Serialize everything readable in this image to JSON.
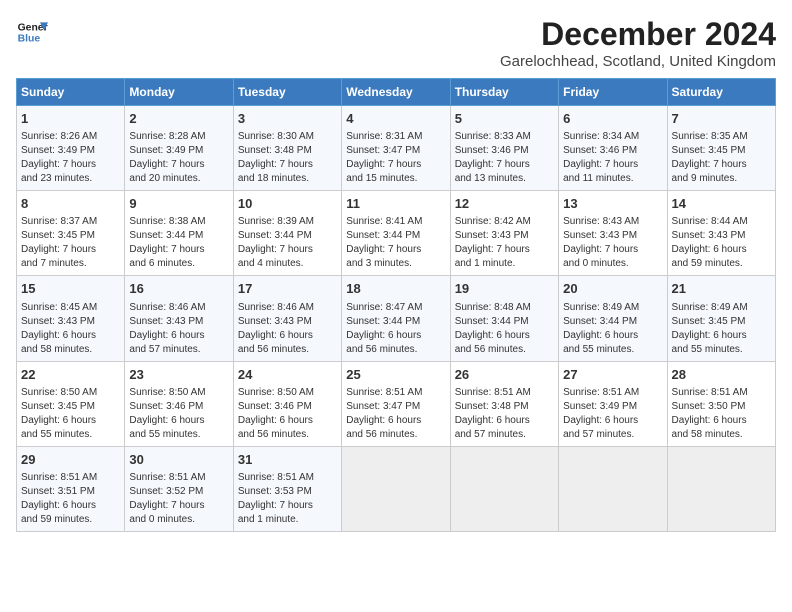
{
  "header": {
    "logo_line1": "General",
    "logo_line2": "Blue",
    "title": "December 2024",
    "subtitle": "Garelochhead, Scotland, United Kingdom"
  },
  "weekdays": [
    "Sunday",
    "Monday",
    "Tuesday",
    "Wednesday",
    "Thursday",
    "Friday",
    "Saturday"
  ],
  "weeks": [
    [
      {
        "day": 1,
        "info": "Sunrise: 8:26 AM\nSunset: 3:49 PM\nDaylight: 7 hours\nand 23 minutes."
      },
      {
        "day": 2,
        "info": "Sunrise: 8:28 AM\nSunset: 3:49 PM\nDaylight: 7 hours\nand 20 minutes."
      },
      {
        "day": 3,
        "info": "Sunrise: 8:30 AM\nSunset: 3:48 PM\nDaylight: 7 hours\nand 18 minutes."
      },
      {
        "day": 4,
        "info": "Sunrise: 8:31 AM\nSunset: 3:47 PM\nDaylight: 7 hours\nand 15 minutes."
      },
      {
        "day": 5,
        "info": "Sunrise: 8:33 AM\nSunset: 3:46 PM\nDaylight: 7 hours\nand 13 minutes."
      },
      {
        "day": 6,
        "info": "Sunrise: 8:34 AM\nSunset: 3:46 PM\nDaylight: 7 hours\nand 11 minutes."
      },
      {
        "day": 7,
        "info": "Sunrise: 8:35 AM\nSunset: 3:45 PM\nDaylight: 7 hours\nand 9 minutes."
      }
    ],
    [
      {
        "day": 8,
        "info": "Sunrise: 8:37 AM\nSunset: 3:45 PM\nDaylight: 7 hours\nand 7 minutes."
      },
      {
        "day": 9,
        "info": "Sunrise: 8:38 AM\nSunset: 3:44 PM\nDaylight: 7 hours\nand 6 minutes."
      },
      {
        "day": 10,
        "info": "Sunrise: 8:39 AM\nSunset: 3:44 PM\nDaylight: 7 hours\nand 4 minutes."
      },
      {
        "day": 11,
        "info": "Sunrise: 8:41 AM\nSunset: 3:44 PM\nDaylight: 7 hours\nand 3 minutes."
      },
      {
        "day": 12,
        "info": "Sunrise: 8:42 AM\nSunset: 3:43 PM\nDaylight: 7 hours\nand 1 minute."
      },
      {
        "day": 13,
        "info": "Sunrise: 8:43 AM\nSunset: 3:43 PM\nDaylight: 7 hours\nand 0 minutes."
      },
      {
        "day": 14,
        "info": "Sunrise: 8:44 AM\nSunset: 3:43 PM\nDaylight: 6 hours\nand 59 minutes."
      }
    ],
    [
      {
        "day": 15,
        "info": "Sunrise: 8:45 AM\nSunset: 3:43 PM\nDaylight: 6 hours\nand 58 minutes."
      },
      {
        "day": 16,
        "info": "Sunrise: 8:46 AM\nSunset: 3:43 PM\nDaylight: 6 hours\nand 57 minutes."
      },
      {
        "day": 17,
        "info": "Sunrise: 8:46 AM\nSunset: 3:43 PM\nDaylight: 6 hours\nand 56 minutes."
      },
      {
        "day": 18,
        "info": "Sunrise: 8:47 AM\nSunset: 3:44 PM\nDaylight: 6 hours\nand 56 minutes."
      },
      {
        "day": 19,
        "info": "Sunrise: 8:48 AM\nSunset: 3:44 PM\nDaylight: 6 hours\nand 56 minutes."
      },
      {
        "day": 20,
        "info": "Sunrise: 8:49 AM\nSunset: 3:44 PM\nDaylight: 6 hours\nand 55 minutes."
      },
      {
        "day": 21,
        "info": "Sunrise: 8:49 AM\nSunset: 3:45 PM\nDaylight: 6 hours\nand 55 minutes."
      }
    ],
    [
      {
        "day": 22,
        "info": "Sunrise: 8:50 AM\nSunset: 3:45 PM\nDaylight: 6 hours\nand 55 minutes."
      },
      {
        "day": 23,
        "info": "Sunrise: 8:50 AM\nSunset: 3:46 PM\nDaylight: 6 hours\nand 55 minutes."
      },
      {
        "day": 24,
        "info": "Sunrise: 8:50 AM\nSunset: 3:46 PM\nDaylight: 6 hours\nand 56 minutes."
      },
      {
        "day": 25,
        "info": "Sunrise: 8:51 AM\nSunset: 3:47 PM\nDaylight: 6 hours\nand 56 minutes."
      },
      {
        "day": 26,
        "info": "Sunrise: 8:51 AM\nSunset: 3:48 PM\nDaylight: 6 hours\nand 57 minutes."
      },
      {
        "day": 27,
        "info": "Sunrise: 8:51 AM\nSunset: 3:49 PM\nDaylight: 6 hours\nand 57 minutes."
      },
      {
        "day": 28,
        "info": "Sunrise: 8:51 AM\nSunset: 3:50 PM\nDaylight: 6 hours\nand 58 minutes."
      }
    ],
    [
      {
        "day": 29,
        "info": "Sunrise: 8:51 AM\nSunset: 3:51 PM\nDaylight: 6 hours\nand 59 minutes."
      },
      {
        "day": 30,
        "info": "Sunrise: 8:51 AM\nSunset: 3:52 PM\nDaylight: 7 hours\nand 0 minutes."
      },
      {
        "day": 31,
        "info": "Sunrise: 8:51 AM\nSunset: 3:53 PM\nDaylight: 7 hours\nand 1 minute."
      },
      null,
      null,
      null,
      null
    ]
  ]
}
